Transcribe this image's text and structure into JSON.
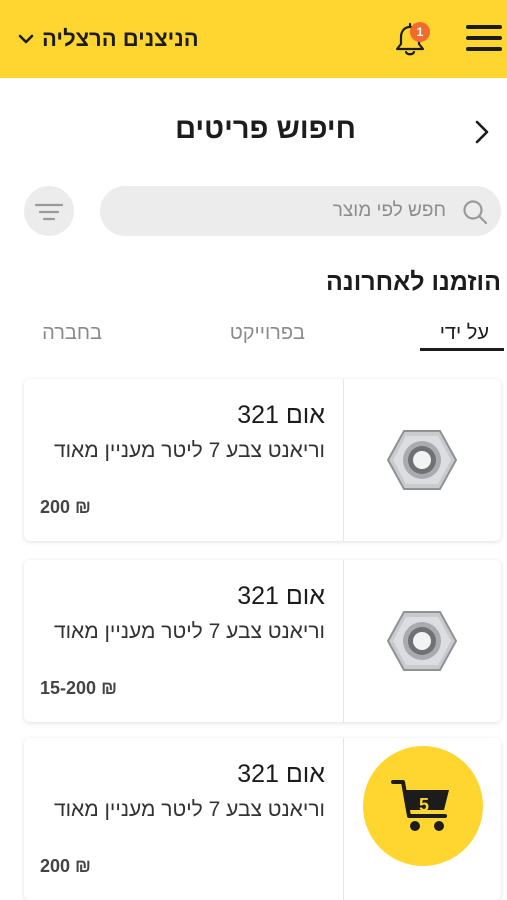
{
  "header": {
    "branch_name": "הניצנים הרצליה",
    "notification_count": "1",
    "icons": [
      "hamburger-menu-icon",
      "bell-icon",
      "chevron-down-icon"
    ],
    "colors": {
      "header_bg": "#FFD630",
      "badge": "#F26B2E"
    }
  },
  "page": {
    "title": "חיפוש פריטים"
  },
  "search": {
    "placeholder": "חפש לפי מוצר"
  },
  "recent": {
    "title": "הוזמנו לאחרונה",
    "tabs": [
      {
        "label": "על ידי",
        "active": true
      },
      {
        "label": "בפרוייקט",
        "active": false
      },
      {
        "label": "בחברה",
        "active": false
      }
    ]
  },
  "products": [
    {
      "name": "אום 321",
      "description": "וריאנט צבע 7 ליטר מעניין מאוד",
      "price": "₪ 200"
    },
    {
      "name": "אום 321",
      "description": "וריאנט צבע 7 ליטר מעניין מאוד",
      "price": "₪ 15-200"
    },
    {
      "name": "אום 321",
      "description": "וריאנט צבע 7 ליטר מעניין מאוד",
      "price": "₪ 200"
    }
  ],
  "cart": {
    "count": "5",
    "color": "#FFD630"
  }
}
